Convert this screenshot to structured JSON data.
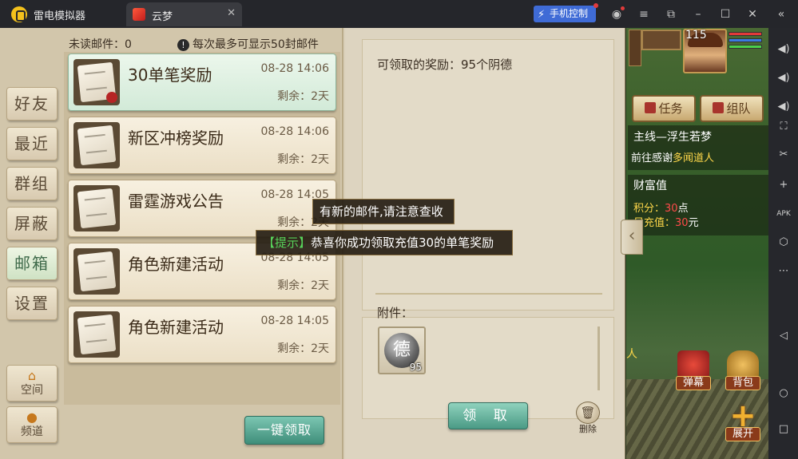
{
  "window": {
    "app_name": "雷电模拟器",
    "tab_label": "云梦",
    "tab_close": "✕",
    "phone_control": "手机控制",
    "phone_control_icon": "⚡",
    "controls": {
      "user": "◉",
      "menu": "≡",
      "popout": "⧉",
      "minimize": "–",
      "maximize": "☐",
      "close": "✕",
      "collapse": "«"
    }
  },
  "side_toolbar": [
    "◀)",
    "◀)",
    "◀)",
    "⛶",
    "✂",
    "+",
    "APK",
    "⬡",
    "⋯",
    "◁",
    "○",
    "□"
  ],
  "nav": {
    "items": [
      {
        "label": "好友"
      },
      {
        "label": "最近"
      },
      {
        "label": "群组"
      },
      {
        "label": "屏蔽"
      },
      {
        "label": "邮箱"
      },
      {
        "label": "设置"
      }
    ],
    "space_label": "空间",
    "space_icon": "⌂",
    "channel_label": "频道",
    "channel_icon": "●"
  },
  "mail": {
    "unread": "未读邮件：0",
    "limit_icon": "!",
    "limit_text": "每次最多可显示50封邮件",
    "items": [
      {
        "title": "30单笔奖励",
        "date": "08-28 14:06",
        "remain": "剩余：2天"
      },
      {
        "title": "新区冲榜奖励",
        "date": "08-28 14:06",
        "remain": "剩余：2天"
      },
      {
        "title": "雷霆游戏公告",
        "date": "08-28 14:05",
        "remain": "剩余：2天"
      },
      {
        "title": "角色新建活动",
        "date": "08-28 14:05",
        "remain": "剩余：2天"
      },
      {
        "title": "角色新建活动",
        "date": "08-28 14:05",
        "remain": "剩余：2天"
      }
    ],
    "collect_all": "一键领取"
  },
  "detail": {
    "reward_text": "可领取的奖励：95个阴德",
    "attachment_label": "附件：",
    "attachment_glyph": "德",
    "attachment_qty": "95",
    "claim": "领 取",
    "delete": "删除",
    "delete_icon": "🗑",
    "collapse_arrow": "‹"
  },
  "toasts": {
    "new_mail": "有新的邮件,请注意查收",
    "tip_tag": "【提示】",
    "tip_text": "恭喜你成功领取充值30的单笔奖励"
  },
  "hud": {
    "level": "115",
    "quest_tab": "任务",
    "team_tab": "组队",
    "quest_title": "主线—浮生若梦",
    "quest_desc_prefix": "前往感谢",
    "quest_desc_npc": "多闻道人",
    "wealth_title": "财富值",
    "score_label": "积分：",
    "score_value": "30",
    "score_unit": "点",
    "charge_label": "日充值：",
    "charge_value": "30",
    "charge_unit": "元",
    "npc_fragment": "人",
    "barrage": "弹幕",
    "bag": "背包",
    "expand": "展开",
    "expand_icon": "+"
  }
}
